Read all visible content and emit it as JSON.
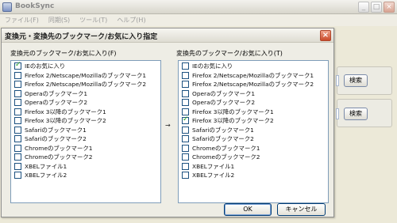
{
  "app": {
    "title": "BookSync",
    "menu": [
      "ファイル(F)",
      "同期(S)",
      "ツール(T)",
      "ヘルプ(H)"
    ],
    "search_buttons": [
      "検索",
      "検索"
    ],
    "window_buttons": {
      "minimize": "_",
      "maximize": "□",
      "close": "×"
    }
  },
  "dialog": {
    "title": "変換元・変換先のブックマーク/お気に入り指定",
    "close_label": "×",
    "source_label": "変換元のブックマーク/お気に入り(F)",
    "target_label": "変換先のブックマーク/お気に入り(T)",
    "arrow": "→",
    "source_items": [
      {
        "label": "IEのお気に入り",
        "checked": true
      },
      {
        "label": "Firefox 2/Netscape/Mozillaのブックマーク1",
        "checked": false
      },
      {
        "label": "Firefox 2/Netscape/Mozillaのブックマーク2",
        "checked": false
      },
      {
        "label": "Operaのブックマーク1",
        "checked": false
      },
      {
        "label": "Operaのブックマーク2",
        "checked": false
      },
      {
        "label": "Firefox 3以降のブックマーク1",
        "checked": false
      },
      {
        "label": "Firefox 3以降のブックマーク2",
        "checked": false
      },
      {
        "label": "Safariのブックマーク1",
        "checked": false
      },
      {
        "label": "Safariのブックマーク2",
        "checked": false
      },
      {
        "label": "Chromeのブックマーク1",
        "checked": false
      },
      {
        "label": "Chromeのブックマーク2",
        "checked": false
      },
      {
        "label": "XBELファイル1",
        "checked": false
      },
      {
        "label": "XBELファイル2",
        "checked": false
      }
    ],
    "target_items": [
      {
        "label": "IEのお気に入り",
        "checked": false
      },
      {
        "label": "Firefox 2/Netscape/Mozillaのブックマーク1",
        "checked": false
      },
      {
        "label": "Firefox 2/Netscape/Mozillaのブックマーク2",
        "checked": false
      },
      {
        "label": "Operaのブックマーク1",
        "checked": false
      },
      {
        "label": "Operaのブックマーク2",
        "checked": false
      },
      {
        "label": "Firefox 3以降のブックマーク1",
        "checked": false
      },
      {
        "label": "Firefox 3以降のブックマーク2",
        "checked": true
      },
      {
        "label": "Safariのブックマーク1",
        "checked": false
      },
      {
        "label": "Safariのブックマーク2",
        "checked": false
      },
      {
        "label": "Chromeのブックマーク1",
        "checked": false
      },
      {
        "label": "Chromeのブックマーク2",
        "checked": false
      },
      {
        "label": "XBELファイル1",
        "checked": false
      },
      {
        "label": "XBELファイル2",
        "checked": false
      }
    ],
    "ok_label": "OK",
    "cancel_label": "キャンセル"
  }
}
